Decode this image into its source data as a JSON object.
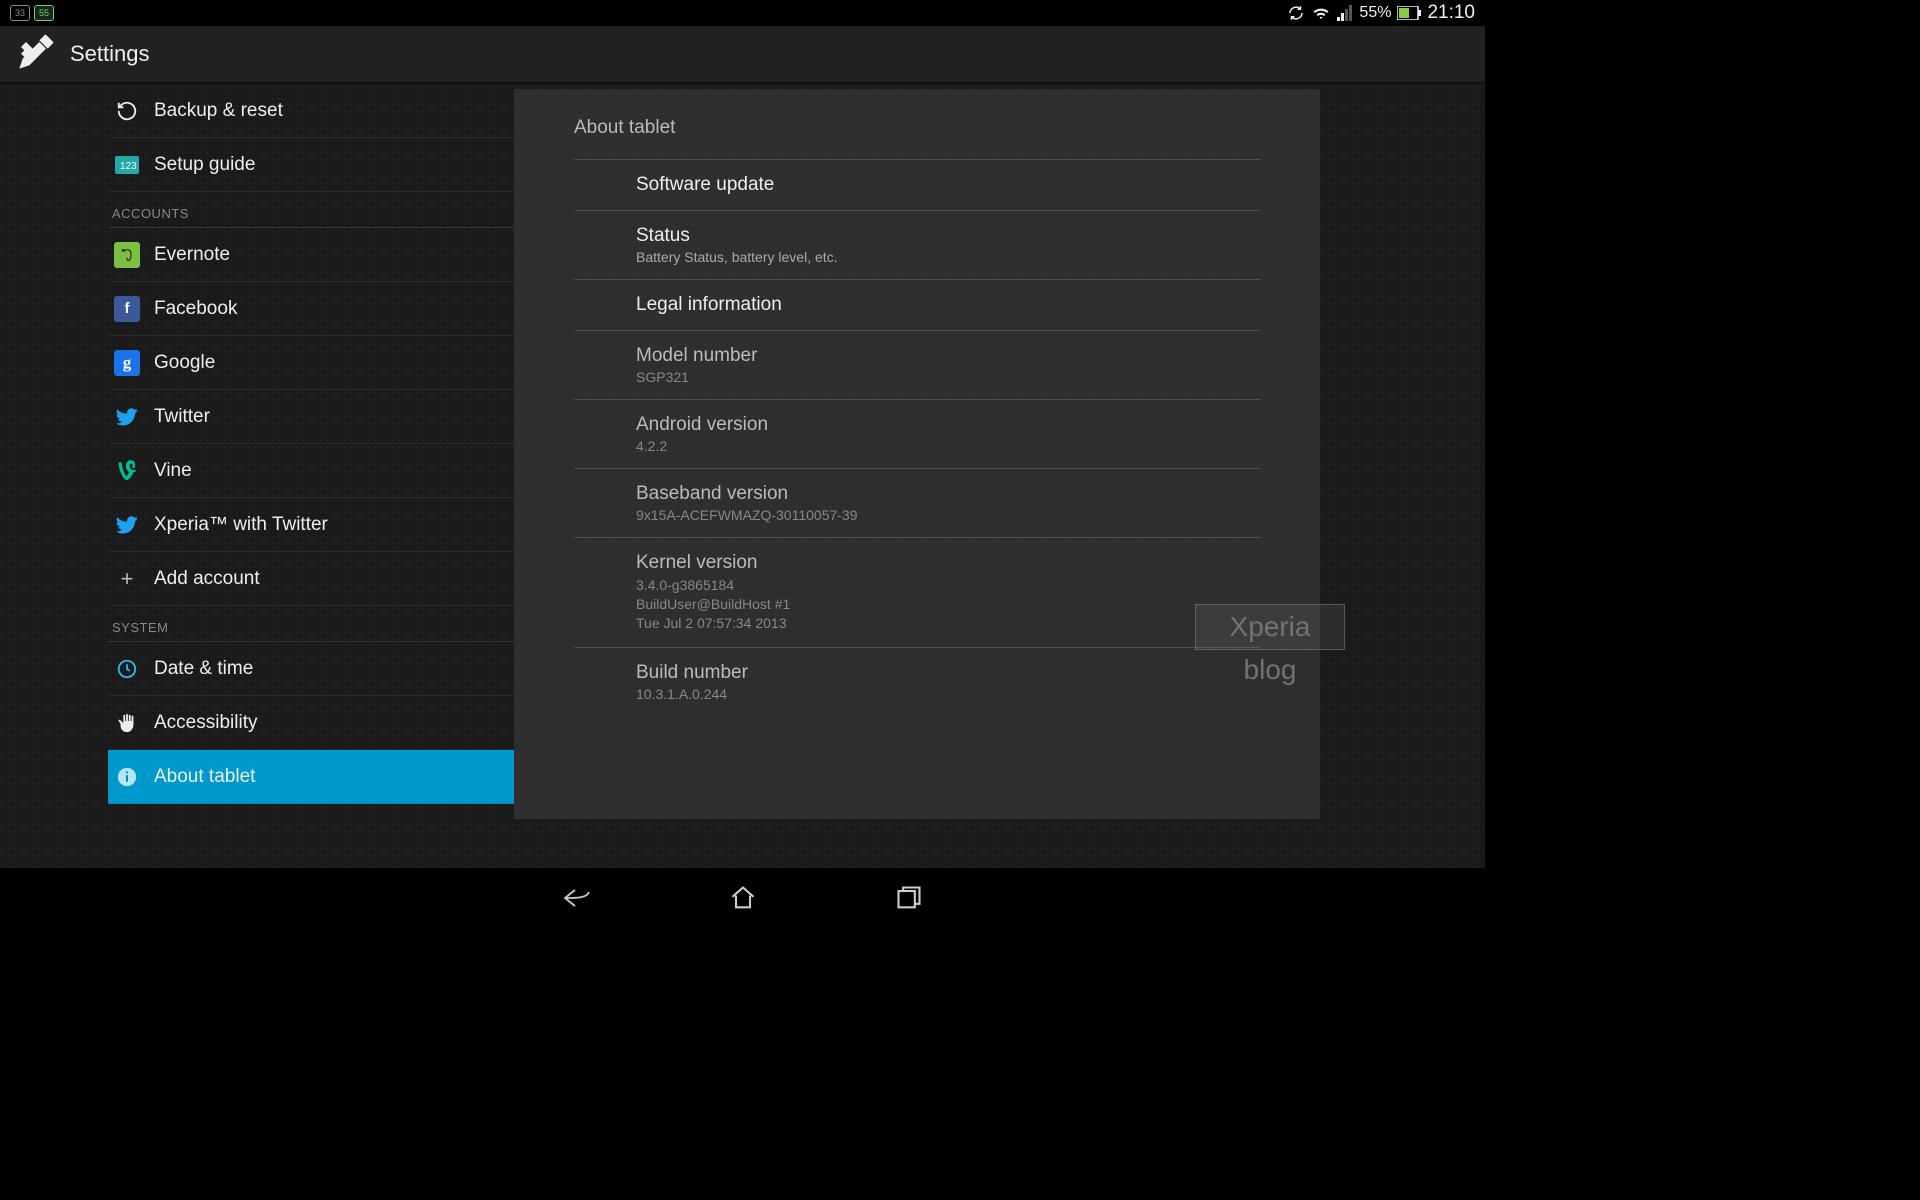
{
  "status": {
    "left_badge_1": "33",
    "left_badge_2": "55",
    "battery_percent": "55%",
    "clock": "21:10"
  },
  "header": {
    "title": "Settings"
  },
  "sidebar": {
    "backup": "Backup & reset",
    "setup": "Setup guide",
    "section_accounts": "ACCOUNTS",
    "evernote": "Evernote",
    "facebook": "Facebook",
    "google": "Google",
    "twitter": "Twitter",
    "vine": "Vine",
    "xperia": "Xperia™ with Twitter",
    "add_account": "Add account",
    "section_system": "SYSTEM",
    "date_time": "Date & time",
    "accessibility": "Accessibility",
    "about": "About tablet"
  },
  "panel": {
    "title": "About tablet",
    "software_update": "Software update",
    "status_title": "Status",
    "status_sub": "Battery Status, battery level, etc.",
    "legal": "Legal information",
    "model_title": "Model number",
    "model_value": "SGP321",
    "android_title": "Android version",
    "android_value": "4.2.2",
    "baseband_title": "Baseband version",
    "baseband_value": "9x15A-ACEFWMAZQ-30110057-39",
    "kernel_title": "Kernel version",
    "kernel_line1": "3.4.0-g3865184",
    "kernel_line2": "BuildUser@BuildHost #1",
    "kernel_line3": "Tue Jul 2 07:57:34 2013",
    "build_title": "Build number",
    "build_value": "10.3.1.A.0.244"
  },
  "watermark": {
    "top": "Xperia",
    "bottom": "blog"
  }
}
